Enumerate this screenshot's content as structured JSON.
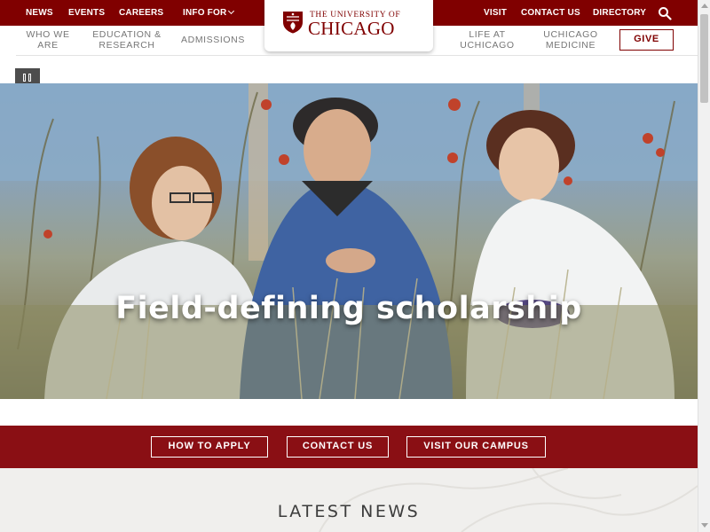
{
  "utility_nav": {
    "news": "NEWS",
    "events": "EVENTS",
    "careers": "CAREERS",
    "info_for": "INFO FOR",
    "visit": "VISIT",
    "contact_us": "CONTACT US",
    "directory": "DIRECTORY"
  },
  "logo": {
    "line1": "THE UNIVERSITY OF",
    "line2": "CHICAGO"
  },
  "main_nav": {
    "who_we_are": "WHO WE\nARE",
    "education_research": "EDUCATION &\nRESEARCH",
    "admissions": "ADMISSIONS",
    "life_at_uchicago": "LIFE AT\nUCHICAGO",
    "uchicago_medicine": "UCHICAGO\nMEDICINE",
    "give": "GIVE"
  },
  "hero": {
    "title": "Field-defining scholarship"
  },
  "cta": {
    "how_to_apply": "HOW TO APPLY",
    "contact_us": "CONTACT US",
    "visit_campus": "VISIT OUR CAMPUS"
  },
  "news": {
    "heading": "LATEST NEWS"
  },
  "icons": {
    "search": "search-icon",
    "pause": "pause-icon",
    "chevron": "chevron-down-icon",
    "shield": "shield-icon"
  },
  "colors": {
    "maroon": "#800000",
    "cta_band": "#8a0f14",
    "news_bg": "#f0efed",
    "nav_text": "#767676"
  }
}
